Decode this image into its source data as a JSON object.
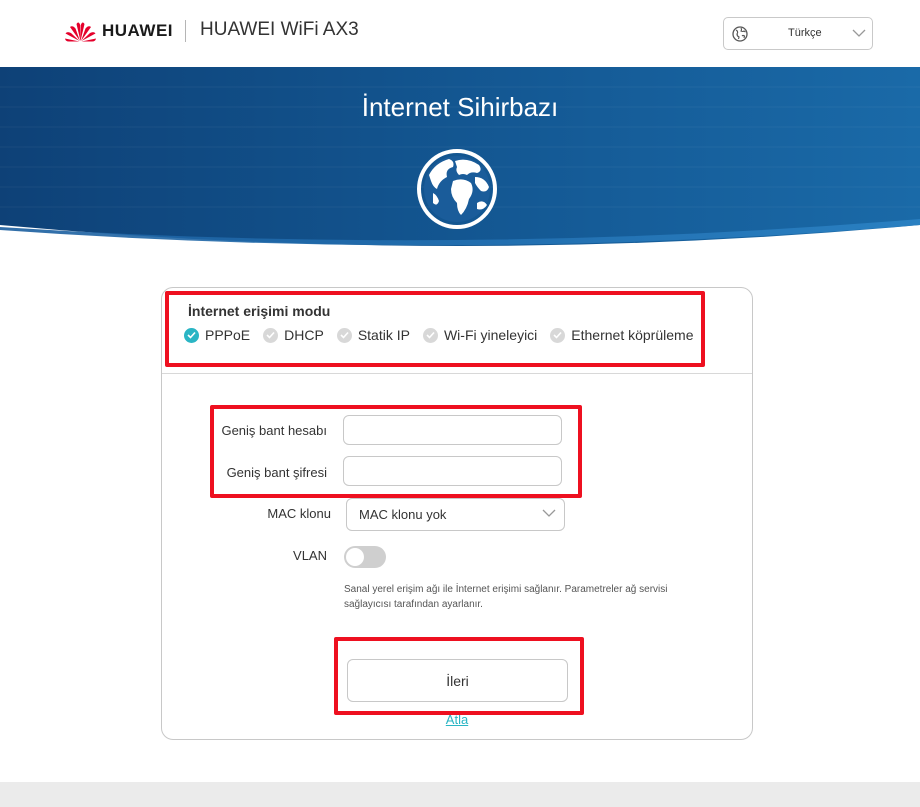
{
  "header": {
    "brand": "HUAWEI",
    "product": "HUAWEI WiFi AX3",
    "language": "Türkçe",
    "icons": {
      "logo": "huawei-logo",
      "globe": "globe-icon",
      "chevron": "chevron-down-icon"
    }
  },
  "banner": {
    "title": "İnternet Sihirbazı",
    "icon": "earth-globe-icon"
  },
  "form": {
    "mode_title": "İnternet erişimi modu",
    "modes": [
      {
        "label": "PPPoE",
        "selected": true
      },
      {
        "label": "DHCP",
        "selected": false
      },
      {
        "label": "Statik IP",
        "selected": false
      },
      {
        "label": "Wi-Fi yineleyici",
        "selected": false
      },
      {
        "label": "Ethernet köprüleme",
        "selected": false
      }
    ],
    "account_label": "Geniş bant hesabı",
    "account_value": "",
    "password_label": "Geniş bant şifresi",
    "password_value": "",
    "mac_label": "MAC klonu",
    "mac_value": "MAC klonu yok",
    "vlan_label": "VLAN",
    "vlan_enabled": false,
    "hint": "Sanal yerel erişim ağı ile İnternet erişimi sağlanır. Parametreler ağ servisi sağlayıcısı tarafından ayarlanır.",
    "next_label": "İleri",
    "skip_label": "Atla"
  },
  "colors": {
    "accent": "#2ab5c4",
    "banner_dark": "#0c3f73",
    "banner_light": "#1a6aa8",
    "highlight": "#ee1020"
  }
}
